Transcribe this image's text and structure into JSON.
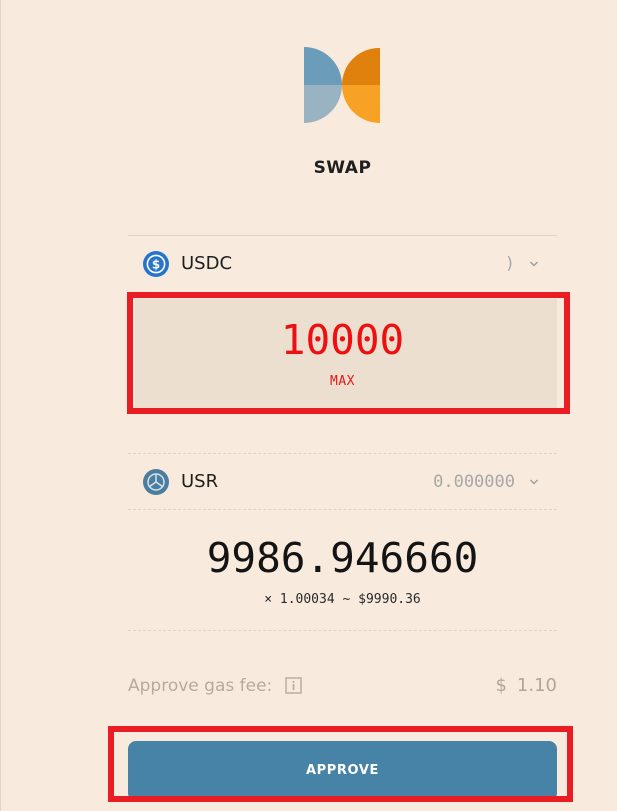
{
  "header": {
    "logo_icon": "swap-logo-icon",
    "title": "SWAP"
  },
  "from_token": {
    "symbol": "USDC",
    "icon": "usdc-coin-icon",
    "balance": ")",
    "amount": "10000",
    "max_label": "MAX"
  },
  "to_token": {
    "symbol": "USR",
    "icon": "usr-coin-icon",
    "balance": "0.000000",
    "amount": "9986.946660",
    "rate_line": "× 1.00034 ~ $9990.36"
  },
  "fees": {
    "label": "Approve gas fee:",
    "currency": "$",
    "value": "1.10"
  },
  "actions": {
    "approve_label": "APPROVE"
  },
  "colors": {
    "background": "#f8ebdd",
    "accent_blue": "#4783a7",
    "highlight_red": "#ea1c24",
    "amount_red": "#ee1010"
  }
}
